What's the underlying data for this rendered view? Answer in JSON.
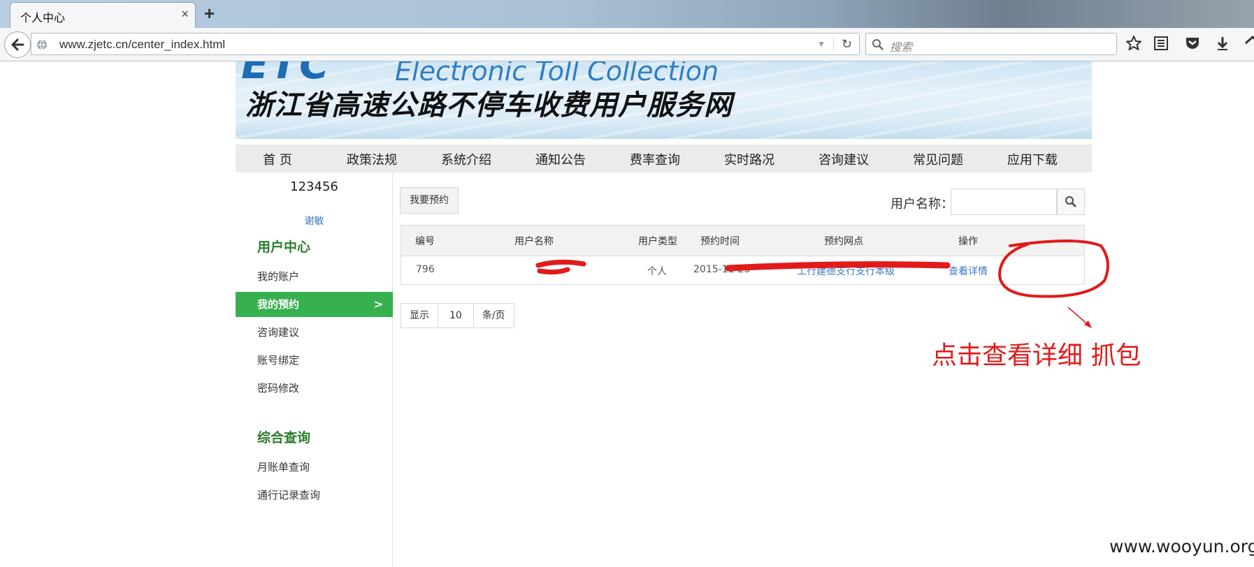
{
  "browser": {
    "tab_title": "个人中心",
    "tab_close": "×",
    "new_tab": "+",
    "url": "www.zjetc.cn/center_index.html",
    "search_placeholder": "搜索"
  },
  "banner": {
    "logo": "ETC",
    "english": "Electronic Toll Collection",
    "title": "浙江省高速公路不停车收费用户服务网"
  },
  "nav": [
    "首 页",
    "政策法规",
    "系统介绍",
    "通知公告",
    "费率查询",
    "实时路况",
    "咨询建议",
    "常见问题",
    "应用下载"
  ],
  "sidebar": {
    "username": "123456",
    "logout": "谢敏",
    "section1": "用户中心",
    "items1": [
      "我的账户",
      "我的预约",
      "咨询建议",
      "账号绑定",
      "密码修改"
    ],
    "active_arrow": ">",
    "section2": "综合查询",
    "items2": [
      "月账单查询",
      "通行记录查询"
    ]
  },
  "content": {
    "reserve_button": "我要预约",
    "filter_label": "用户名称：",
    "table": {
      "headers": [
        "编号",
        "用户名称",
        "用户类型",
        "预约时间",
        "预约网点",
        "操作"
      ],
      "rows": [
        {
          "id": "796",
          "name": "",
          "type": "个人",
          "time": "2015-11-25",
          "branch": "工行建德支行支行本级",
          "action": "查看详情"
        }
      ]
    },
    "pager": {
      "show": "显示",
      "size": "10",
      "unit": "条/页"
    }
  },
  "annotation": {
    "note": "点击查看详细  抓包",
    "color": "#e21a1a"
  },
  "watermark": "www.wooyun.org"
}
